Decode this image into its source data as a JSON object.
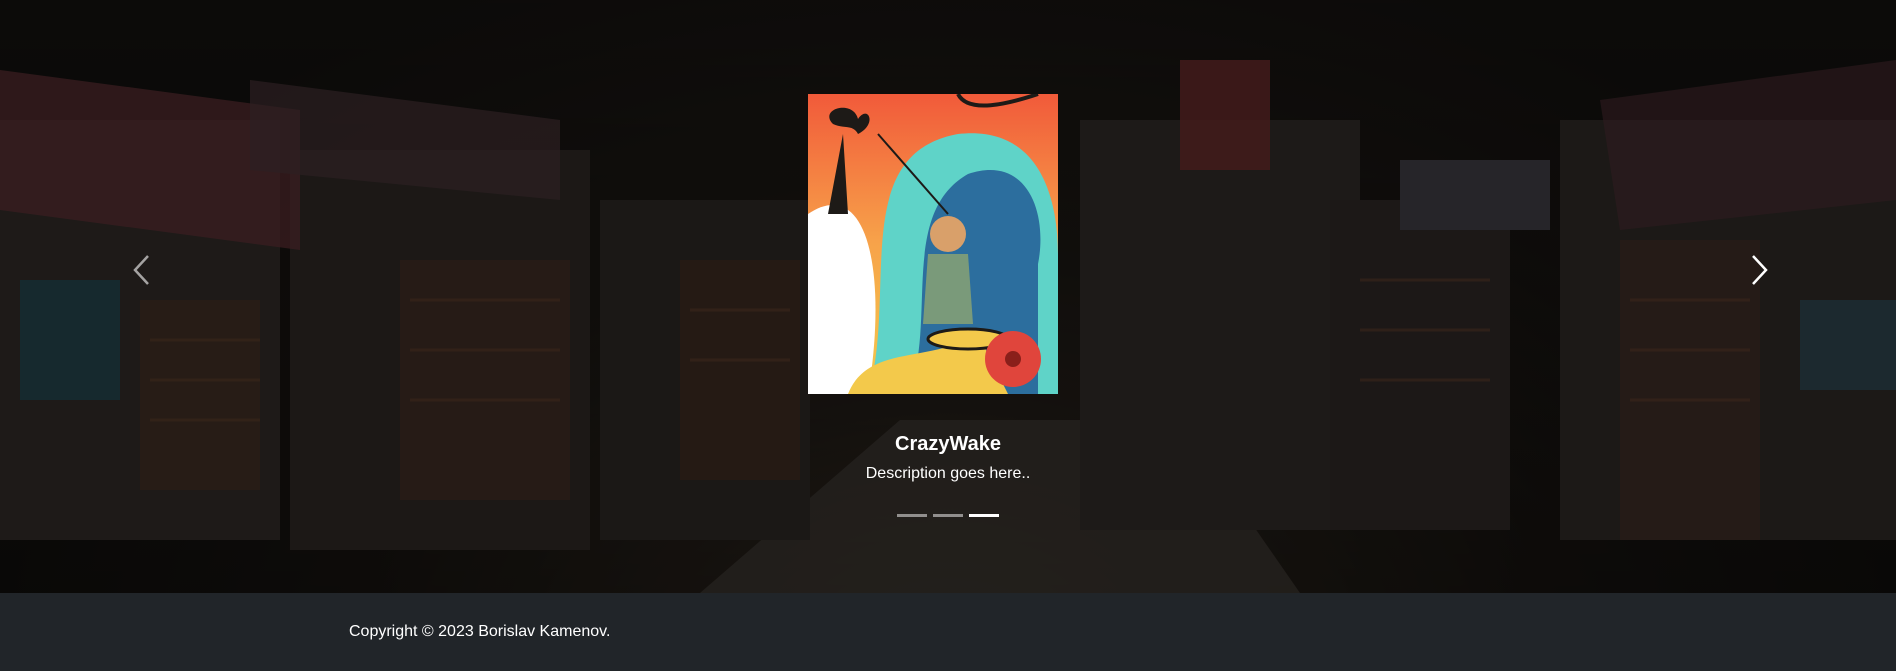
{
  "carousel": {
    "slides": [
      {
        "title": "CrazyWake",
        "description": "Description goes here..",
        "active": true
      }
    ],
    "indicator_count": 3,
    "active_indicator": 3,
    "controls": {
      "prev_icon": "chevron-left-icon",
      "next_icon": "chevron-right-icon"
    }
  },
  "footer": {
    "copyright": "Copyright © 2023 Borislav Kamenov."
  },
  "colors": {
    "footer_bg": "#212529",
    "text": "#ffffff",
    "art_orange": "#f26b3a",
    "art_teal": "#5fd3c8",
    "art_yellow": "#f3c94b"
  }
}
